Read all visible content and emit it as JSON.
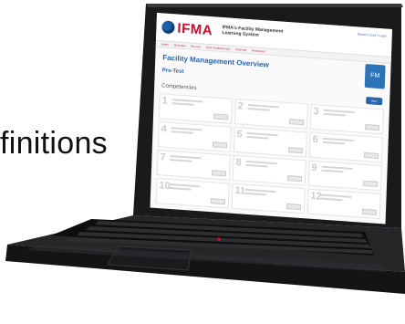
{
  "caption": {
    "text": "finitions"
  },
  "screen": {
    "logo_text": "IFMA",
    "system_title": "IFMA's Facility Management Learning System",
    "top_links": "Search | Cart | Login",
    "nav_items": [
      "Home",
      "Overview",
      "Pre-test",
      "Core Competencies",
      "Post-test",
      "Resources"
    ],
    "overview_title": "Facility Management Overview",
    "overview_subtitle": "",
    "pretest_label": "Pre-Test",
    "badge_text": "FM",
    "competencies_label": "Competencies",
    "start_button": "Start",
    "tiles": [
      {
        "num": "1"
      },
      {
        "num": "2"
      },
      {
        "num": "3"
      },
      {
        "num": "4"
      },
      {
        "num": "5"
      },
      {
        "num": "6"
      },
      {
        "num": "7"
      },
      {
        "num": "8"
      },
      {
        "num": "9"
      },
      {
        "num": "10"
      },
      {
        "num": "11"
      },
      {
        "num": "12"
      }
    ]
  },
  "colors": {
    "brand_red": "#c8102e",
    "brand_blue": "#2a66b0",
    "laptop_body": "#1c1c1e"
  }
}
